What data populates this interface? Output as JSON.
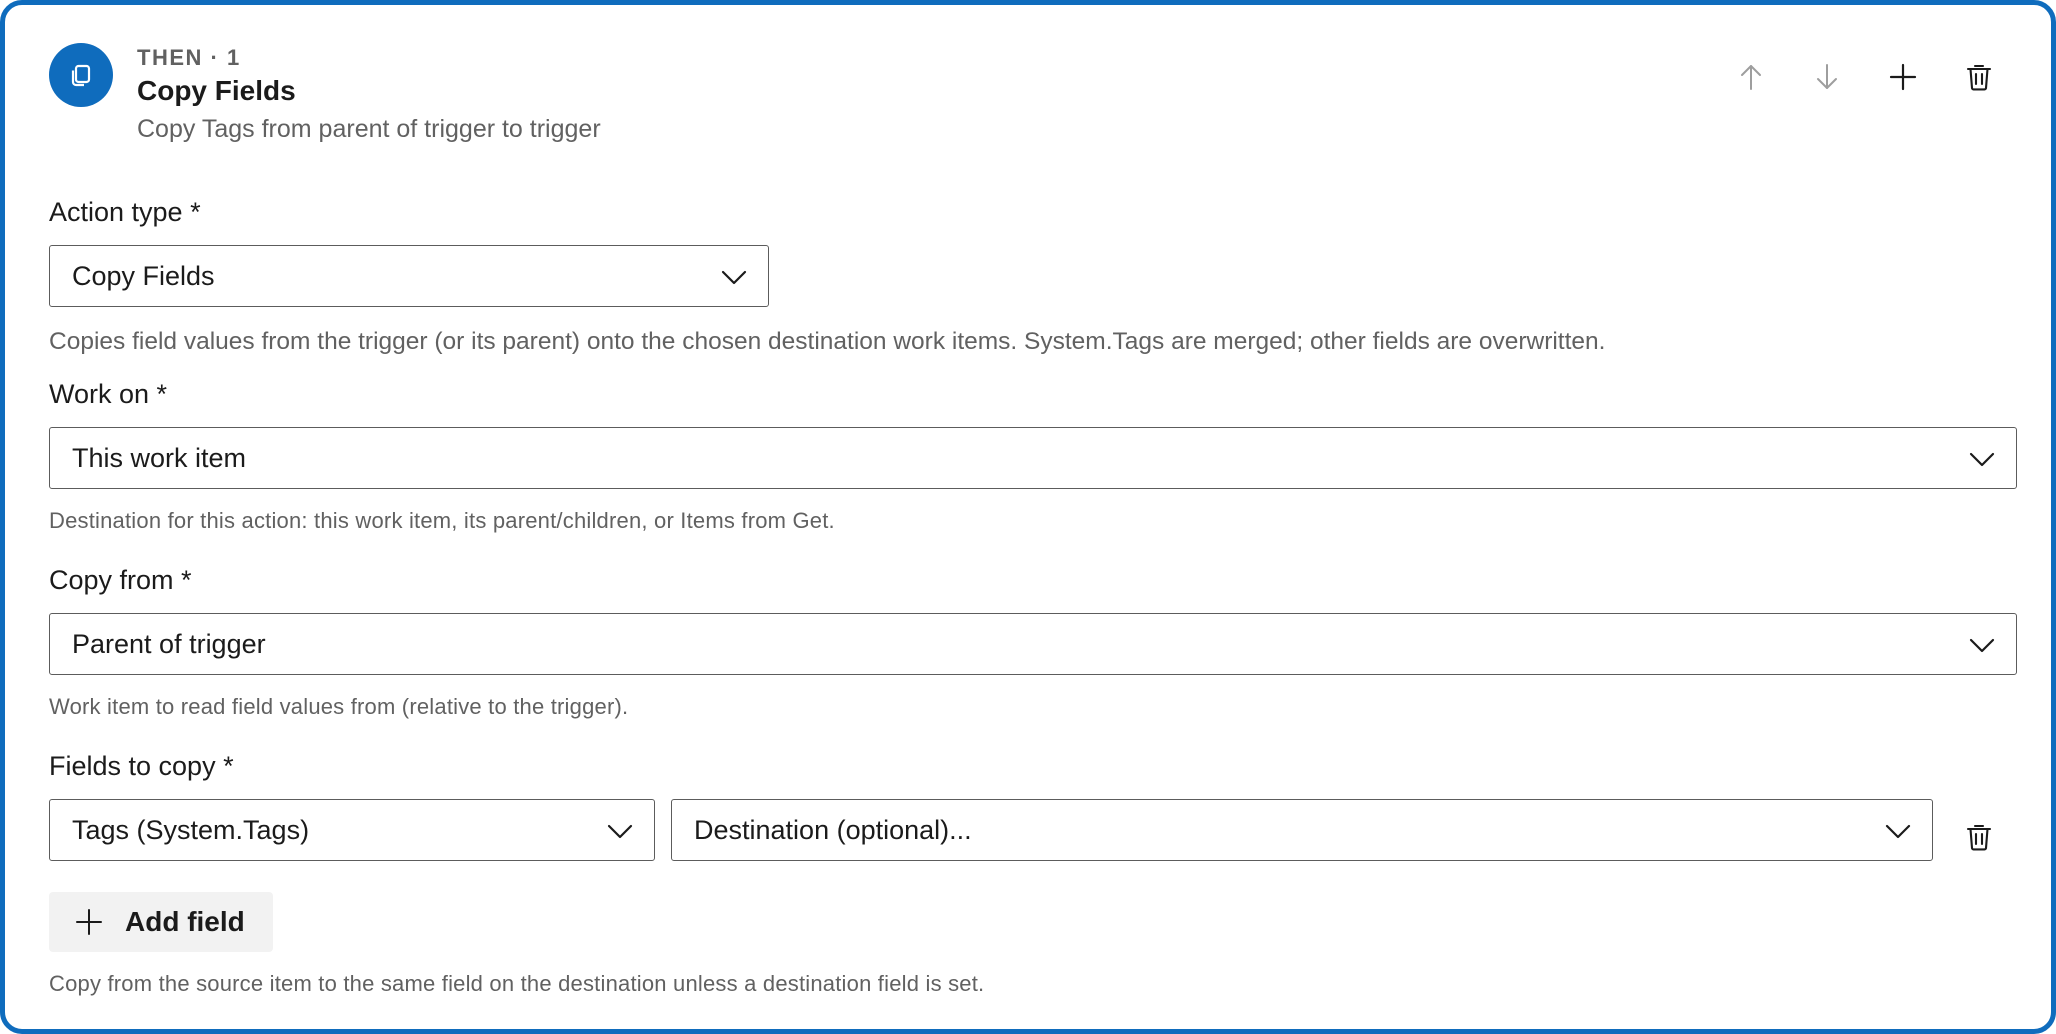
{
  "header": {
    "eyebrow": "THEN · 1",
    "title": "Copy Fields",
    "subtitle": "Copy Tags from parent of trigger to trigger"
  },
  "toolbar": {
    "icons": [
      "arrow-up-icon",
      "arrow-down-icon",
      "plus-icon",
      "trash-icon"
    ]
  },
  "action_type": {
    "label": "Action type *",
    "value": "Copy Fields",
    "description": "Copies field values from the trigger (or its parent) onto the chosen destination work items. System.Tags are merged; other fields are overwritten."
  },
  "work_on": {
    "label": "Work on *",
    "value": "This work item",
    "help": "Destination for this action: this work item, its parent/children, or Items from Get."
  },
  "copy_from": {
    "label": "Copy from *",
    "value": "Parent of trigger",
    "help": "Work item to read field values from (relative to the trigger)."
  },
  "fields_to_copy": {
    "label": "Fields to copy *",
    "rows": [
      {
        "source": "Tags (System.Tags)",
        "destination": "Destination (optional)..."
      }
    ],
    "add_label": "Add field",
    "help": "Copy from the source item to the same field on the destination unless a destination field is set."
  },
  "colors": {
    "accent": "#0f6cbd",
    "text": "#1b1b1b",
    "secondary_text": "#616161",
    "disabled_icon": "#9e9e9e"
  }
}
